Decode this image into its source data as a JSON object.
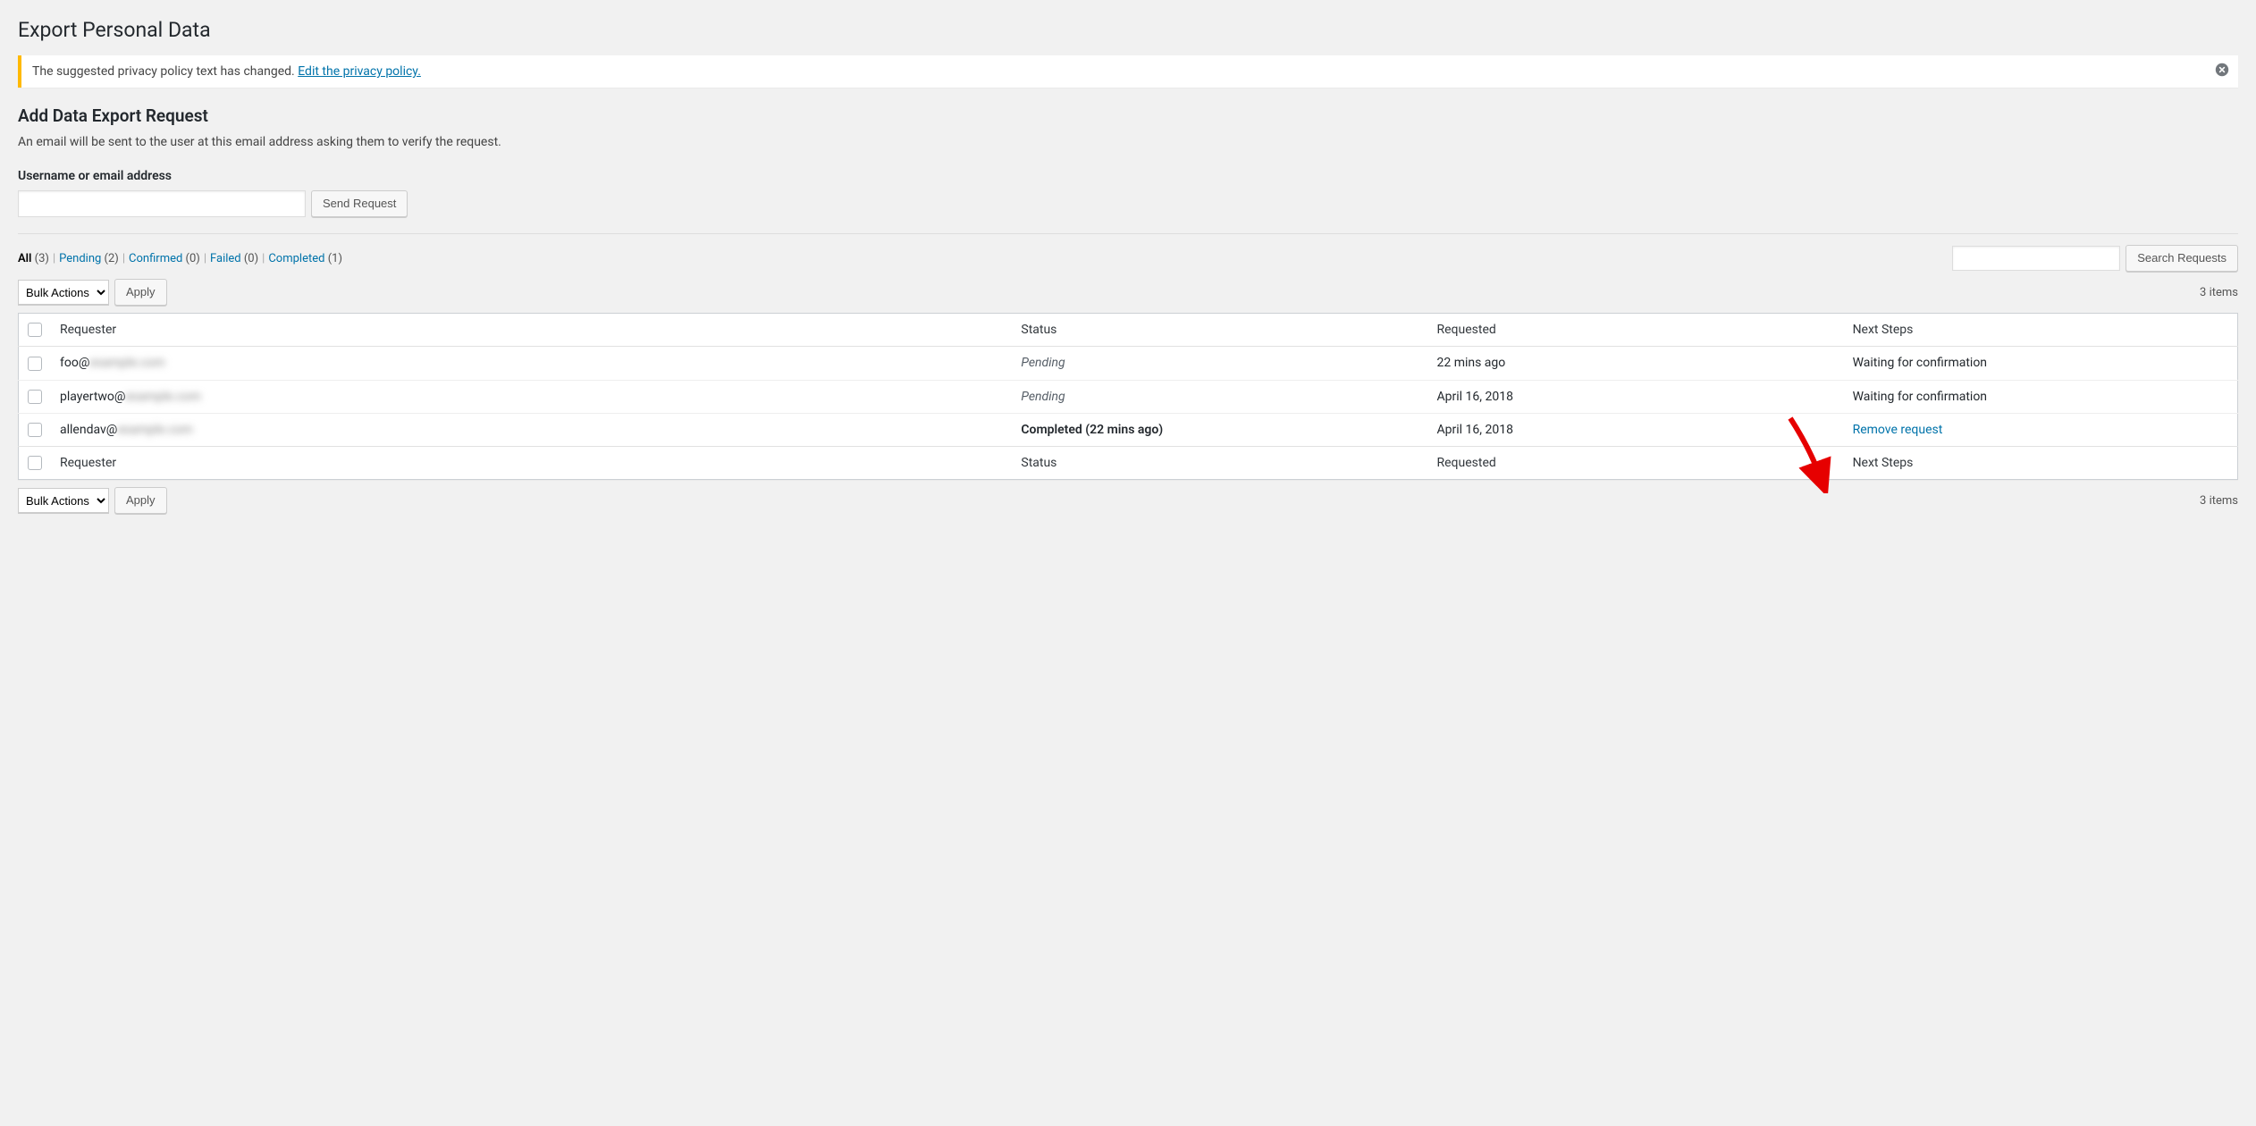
{
  "page": {
    "title": "Export Personal Data",
    "notice_text": "The suggested privacy policy text has changed. ",
    "notice_link": "Edit the privacy policy.",
    "subheading": "Add Data Export Request",
    "description": "An email will be sent to the user at this email address asking them to verify the request.",
    "form_label": "Username or email address",
    "send_button": "Send Request",
    "search_button": "Search Requests",
    "bulk_label": "Bulk Actions",
    "apply_label": "Apply",
    "items_count": "3 items"
  },
  "filters": [
    {
      "label": "All",
      "count": "(3)",
      "current": true
    },
    {
      "label": "Pending",
      "count": "(2)",
      "current": false
    },
    {
      "label": "Confirmed",
      "count": "(0)",
      "current": false
    },
    {
      "label": "Failed",
      "count": "(0)",
      "current": false
    },
    {
      "label": "Completed",
      "count": "(1)",
      "current": false
    }
  ],
  "columns": {
    "requester": "Requester",
    "status": "Status",
    "requested": "Requested",
    "next": "Next Steps"
  },
  "rows": [
    {
      "requester_prefix": "foo@",
      "requester_redacted": "example.com",
      "status": "Pending",
      "status_class": "pending",
      "requested": "22 mins ago",
      "next": "Waiting for confirmation",
      "next_link": false
    },
    {
      "requester_prefix": "playertwo@",
      "requester_redacted": "example.com",
      "status": "Pending",
      "status_class": "pending",
      "requested": "April 16, 2018",
      "next": "Waiting for confirmation",
      "next_link": false
    },
    {
      "requester_prefix": "allendav@",
      "requester_redacted": "example.com",
      "status": "Completed (22 mins ago)",
      "status_class": "completed",
      "requested": "April 16, 2018",
      "next": "Remove request",
      "next_link": true
    }
  ]
}
